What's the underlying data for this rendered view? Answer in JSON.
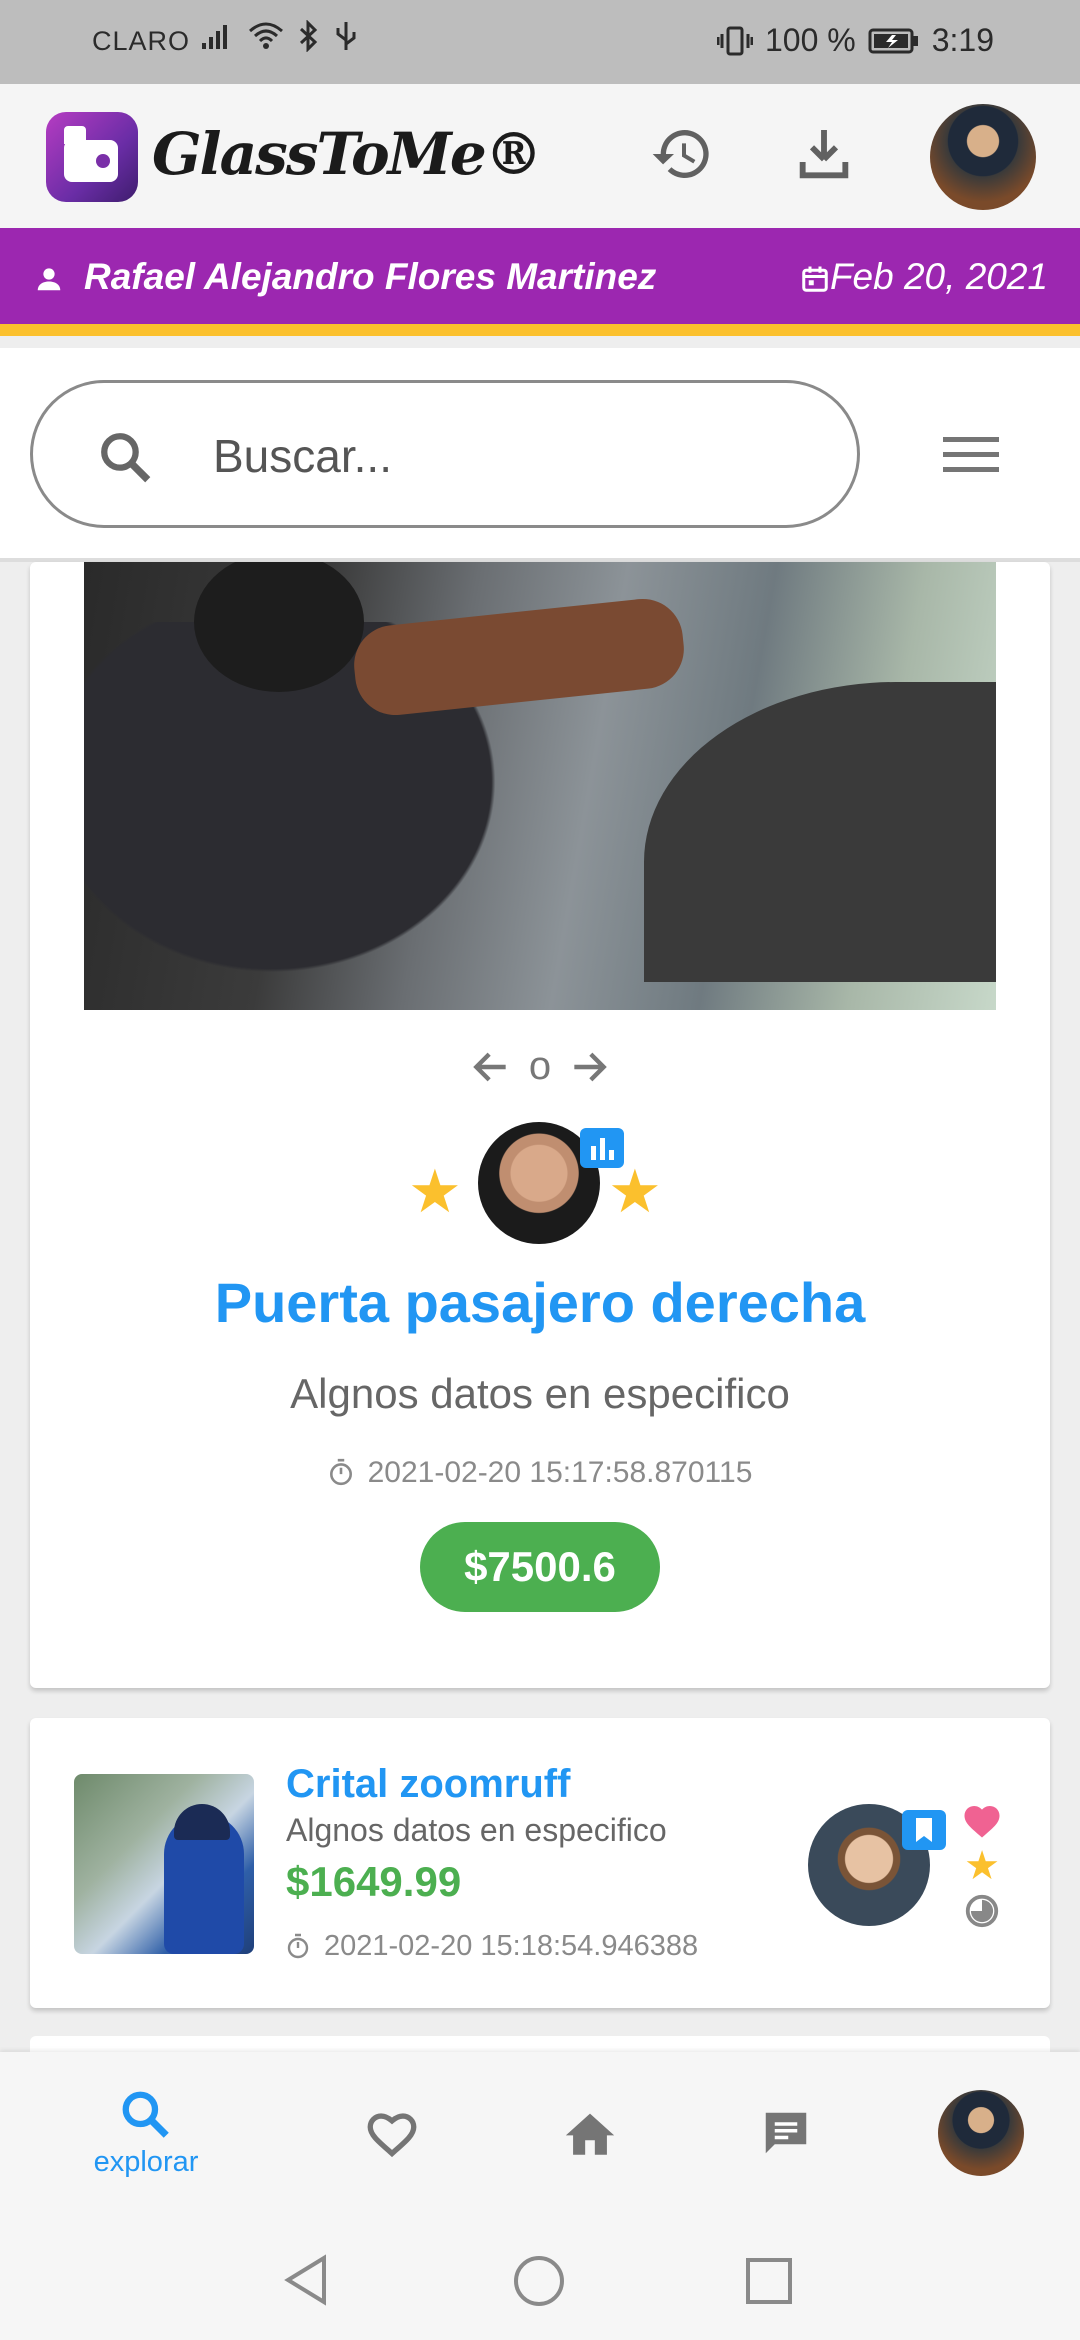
{
  "status_bar": {
    "carrier": "CLARO",
    "battery": "100 %",
    "time": "3:19"
  },
  "app_bar": {
    "brand": "GlassToMe®"
  },
  "user_bar": {
    "name": "Rafael Alejandro Flores Martinez",
    "date": "Feb 20, 2021"
  },
  "search": {
    "placeholder": "Buscar..."
  },
  "featured": {
    "page_indicator": "o",
    "rating_stars": 2,
    "title": "Puerta pasajero derecha",
    "subtitle": "Algnos datos en especifico",
    "timestamp": "2021-02-20 15:17:58.870115",
    "price": "$7500.6"
  },
  "listing": {
    "title": "Crital zoomruff",
    "subtitle": "Algnos datos en especifico",
    "price": "$1649.99",
    "timestamp": "2021-02-20 15:18:54.946388"
  },
  "bottom_nav": {
    "explore_label": "explorar"
  },
  "colors": {
    "purple": "#9c27b0",
    "yellow": "#fbc02d",
    "blue": "#2196f3",
    "green": "#4caf50",
    "heart": "#f06292"
  }
}
